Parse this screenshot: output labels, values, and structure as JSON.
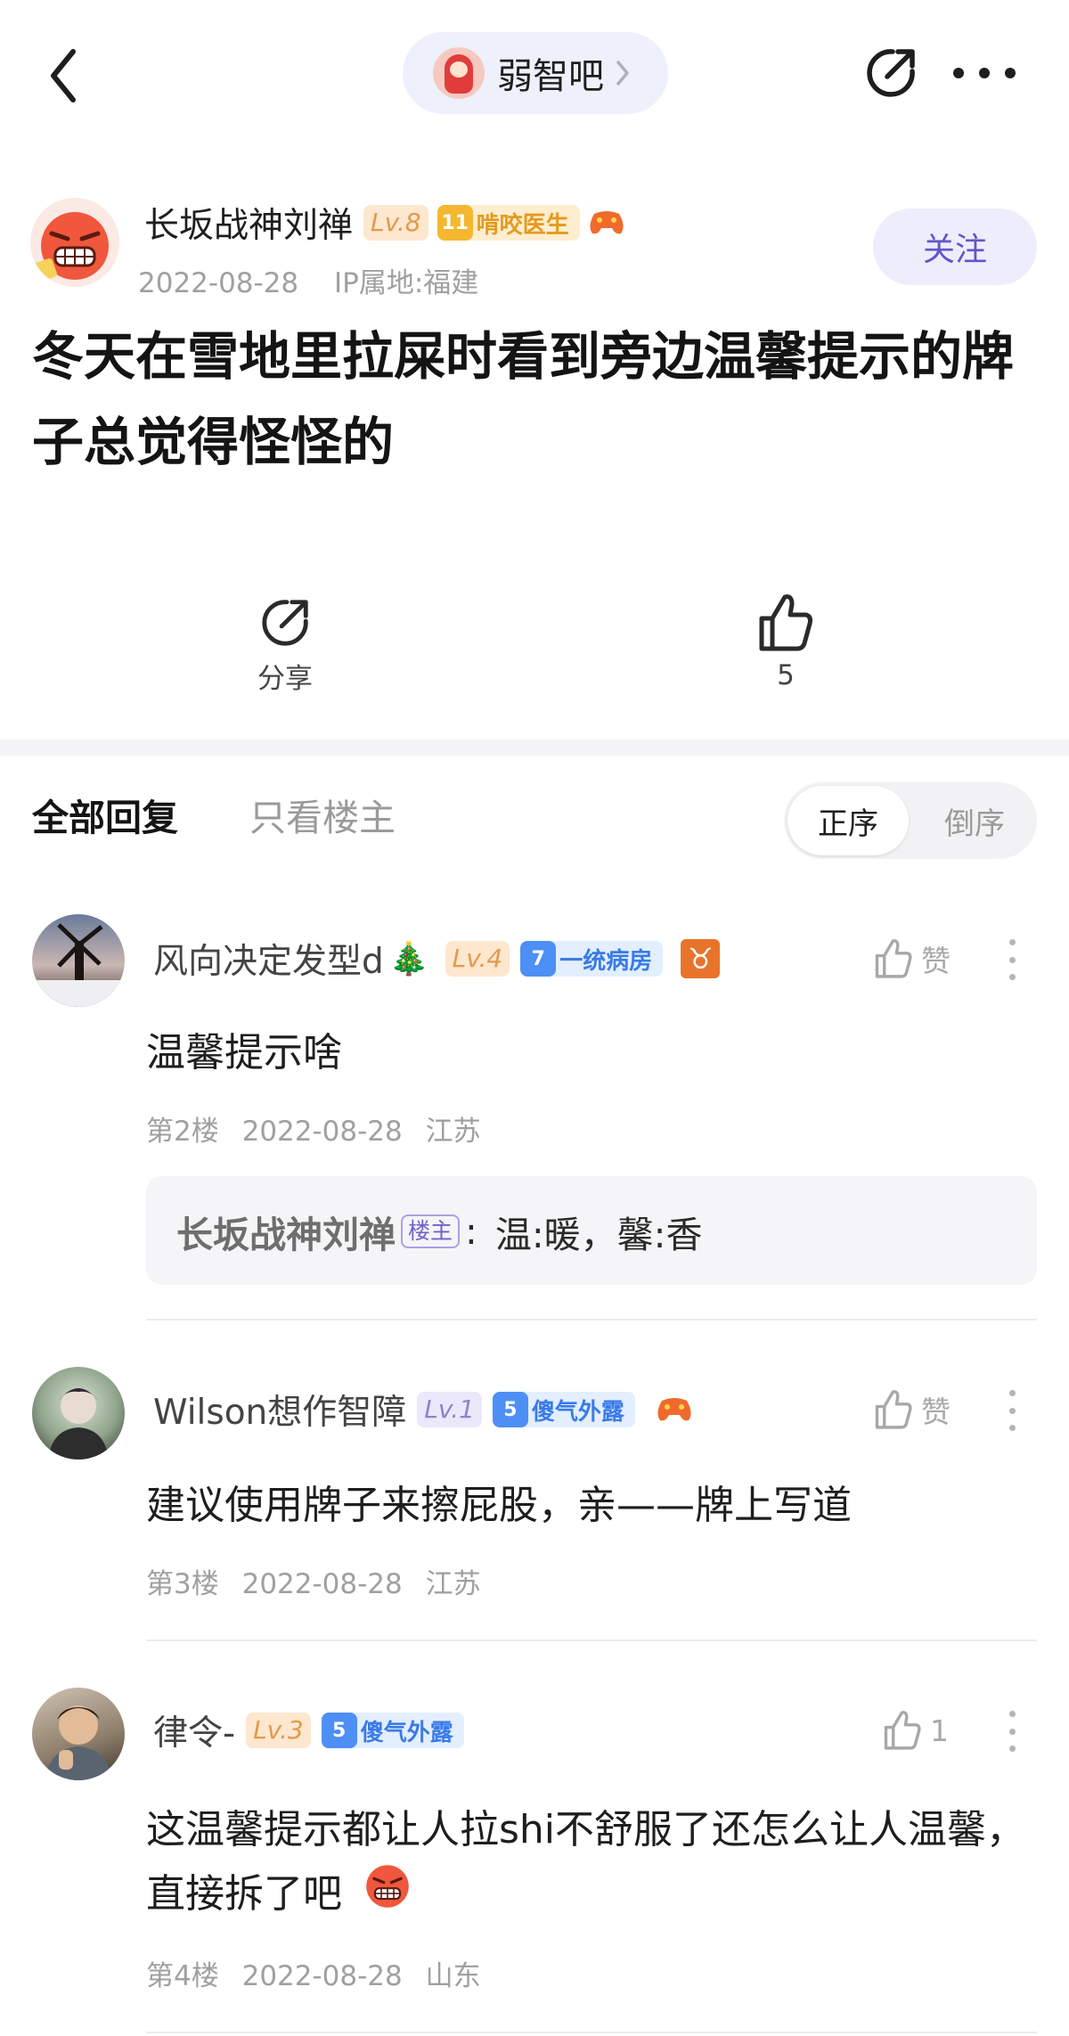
{
  "nav": {
    "forum_name": "弱智吧"
  },
  "post": {
    "author": {
      "name": "长坂战神刘禅",
      "level": "Lv.8",
      "title_level": "11",
      "title": "啃咬医生",
      "date": "2022-08-28",
      "ip": "IP属地:福建"
    },
    "follow_label": "关注",
    "title": "冬天在雪地里拉屎时看到旁边温馨提示的牌子总觉得怪怪的",
    "share_label": "分享",
    "like_count": "5"
  },
  "replies_header": {
    "tab_all": "全部回复",
    "tab_op_only": "只看楼主",
    "sort_asc": "正序",
    "sort_desc": "倒序"
  },
  "comments": [
    {
      "name": "风向决定发型d",
      "emoji": "🎄",
      "level": "Lv.4",
      "title_level": "7",
      "title": "一统病房",
      "zodiac": "♉",
      "like_label": "赞",
      "body": "温馨提示啥",
      "floor": "第2楼",
      "date": "2022-08-28",
      "location": "江苏",
      "reply": {
        "name": "长坂战神刘禅",
        "tag": "楼主",
        "colon": ":",
        "text": "温:暖，馨:香"
      }
    },
    {
      "name": "Wilson想作智障",
      "level": "Lv.1",
      "title_level": "5",
      "title": "傻气外露",
      "like_label": "赞",
      "body": "建议使用牌子来擦屁股，亲——牌上写道",
      "floor": "第3楼",
      "date": "2022-08-28",
      "location": "江苏"
    },
    {
      "name": "律令-",
      "level": "Lv.3",
      "title_level": "5",
      "title": "傻气外露",
      "like_label": "1",
      "body": "这温馨提示都让人拉shi不舒服了还怎么让人温馨，直接拆了吧",
      "floor": "第4楼",
      "date": "2022-08-28",
      "location": "山东"
    }
  ],
  "colors": {
    "accent": "#5f57c8",
    "follow_bg": "#eeedfb",
    "level_orange": "#e29a4b",
    "title_gold": "#e59a1d",
    "title_blue": "#3a7be8"
  },
  "icons": [
    "back-arrow-icon",
    "chevron-right-icon",
    "share-icon",
    "more-icon",
    "thumbs-up-icon",
    "game-controller-icon",
    "angry-emoji-icon"
  ]
}
